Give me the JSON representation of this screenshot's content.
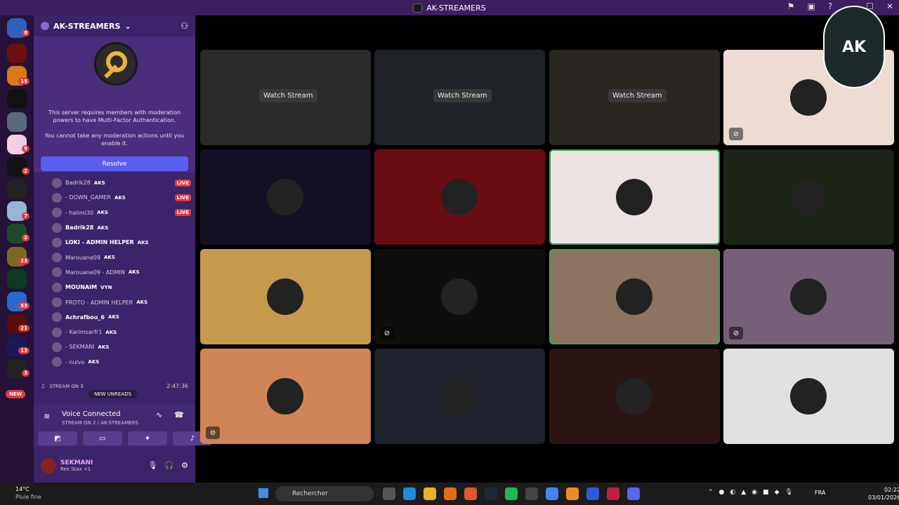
{
  "window": {
    "title": "AK-STREAMERS"
  },
  "server": {
    "name": "AK-STREAMERS",
    "mfa_text_1": "This server requires members with moderation powers to have Multi-Factor Authentication.",
    "mfa_text_2": "You cannot take any moderation actions until you enable it.",
    "resolve_label": "Resolve"
  },
  "rail": {
    "badges": [
      "8",
      "15",
      "9",
      "2",
      "7",
      "2",
      "23",
      "53",
      "21",
      "13",
      "3"
    ],
    "new_label": "NEW"
  },
  "members": [
    {
      "name": "Badrik28",
      "tag": "AKS",
      "live": "LIVE"
    },
    {
      "name": "- DOWN_GAMER",
      "tag": "AKS",
      "live": "LIVE"
    },
    {
      "name": "- halimi30",
      "tag": "AKS",
      "live": "LIVE"
    },
    {
      "name": "Badrik28",
      "tag": "AKS",
      "live": ""
    },
    {
      "name": "LOKI - ADMIN HELPER",
      "tag": "AKS",
      "live": ""
    },
    {
      "name": "Marouane09",
      "tag": "AKS",
      "live": ""
    },
    {
      "name": "Marouane09 - ADMIN",
      "tag": "AKS",
      "live": ""
    },
    {
      "name": "MOUNAIM",
      "tag": "VYN",
      "live": ""
    },
    {
      "name": "PROTO - ADMIN HELPER",
      "tag": "AKS",
      "live": ""
    },
    {
      "name": "Achrafbou_6",
      "tag": "AKS",
      "live": ""
    },
    {
      "name": "- Karimsarfr1",
      "tag": "AKS",
      "live": ""
    },
    {
      "name": "- SEKMANI",
      "tag": "AKS",
      "live": ""
    },
    {
      "name": "- nulvo",
      "tag": "AKS",
      "live": ""
    }
  ],
  "stream_row": {
    "label": "STREAM ON 3",
    "timer": "2:47:36"
  },
  "unreads_label": "NEW UNREADS",
  "voice": {
    "title": "Voice Connected",
    "subtitle": "STREAM ON 2 / AK-STREAMERS"
  },
  "user": {
    "name": "SEKMANI",
    "status": "Rex Stax +1"
  },
  "tiles": [
    {
      "bg": "#2a2a2a",
      "watch": "Watch Stream"
    },
    {
      "bg": "#1f2227",
      "watch": "Watch Stream"
    },
    {
      "bg": "#2a2622",
      "watch": "Watch Stream"
    },
    {
      "bg": "#ecdcd4",
      "watch": ""
    },
    {
      "bg": "#150f24",
      "watch": ""
    },
    {
      "bg": "#6a0d12",
      "watch": ""
    },
    {
      "bg": "#ede2e2",
      "watch": ""
    },
    {
      "bg": "#1c2418",
      "watch": ""
    },
    {
      "bg": "#c69a4d",
      "watch": ""
    },
    {
      "bg": "#0e0e0e",
      "watch": ""
    },
    {
      "bg": "#8c7460",
      "watch": ""
    },
    {
      "bg": "#766078",
      "watch": ""
    },
    {
      "bg": "#cf8557",
      "watch": ""
    },
    {
      "bg": "#1e222c",
      "watch": ""
    },
    {
      "bg": "#2a1414",
      "watch": ""
    },
    {
      "bg": "#e1e1e1",
      "watch": ""
    }
  ],
  "watermark": "AK",
  "taskbar": {
    "temp": "14°C",
    "weather": "Pluie fine",
    "search_placeholder": "Rechercher",
    "lang": "FRA",
    "time": "02:22",
    "date": "03/01/2026"
  }
}
